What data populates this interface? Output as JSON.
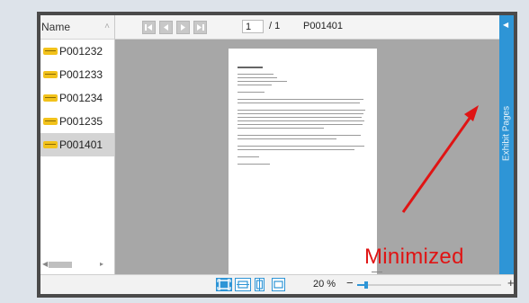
{
  "file_list": {
    "header": "Name",
    "collapse_glyph": "˄",
    "items": [
      {
        "label": "P001232",
        "selected": false
      },
      {
        "label": "P001233",
        "selected": false
      },
      {
        "label": "P001234",
        "selected": false
      },
      {
        "label": "P001235",
        "selected": false
      },
      {
        "label": "P001401",
        "selected": true
      }
    ]
  },
  "viewer": {
    "nav_icons": [
      "first-page-icon",
      "previous-page-icon",
      "next-page-icon",
      "last-page-icon"
    ],
    "current_page": "1",
    "page_total": "/ 1",
    "document_id": "P001401"
  },
  "annotation": {
    "text": "Minimized",
    "color": "#e01414"
  },
  "side_tab": {
    "label": "Exhibit Pages",
    "color": "#2e95d6"
  },
  "zoom": {
    "icons": [
      "fit-page-icon",
      "fit-width-icon",
      "fit-height-icon",
      "actual-size-icon"
    ],
    "value": "20 %",
    "minus": "−",
    "plus": "+",
    "level_fraction": 0.2
  }
}
